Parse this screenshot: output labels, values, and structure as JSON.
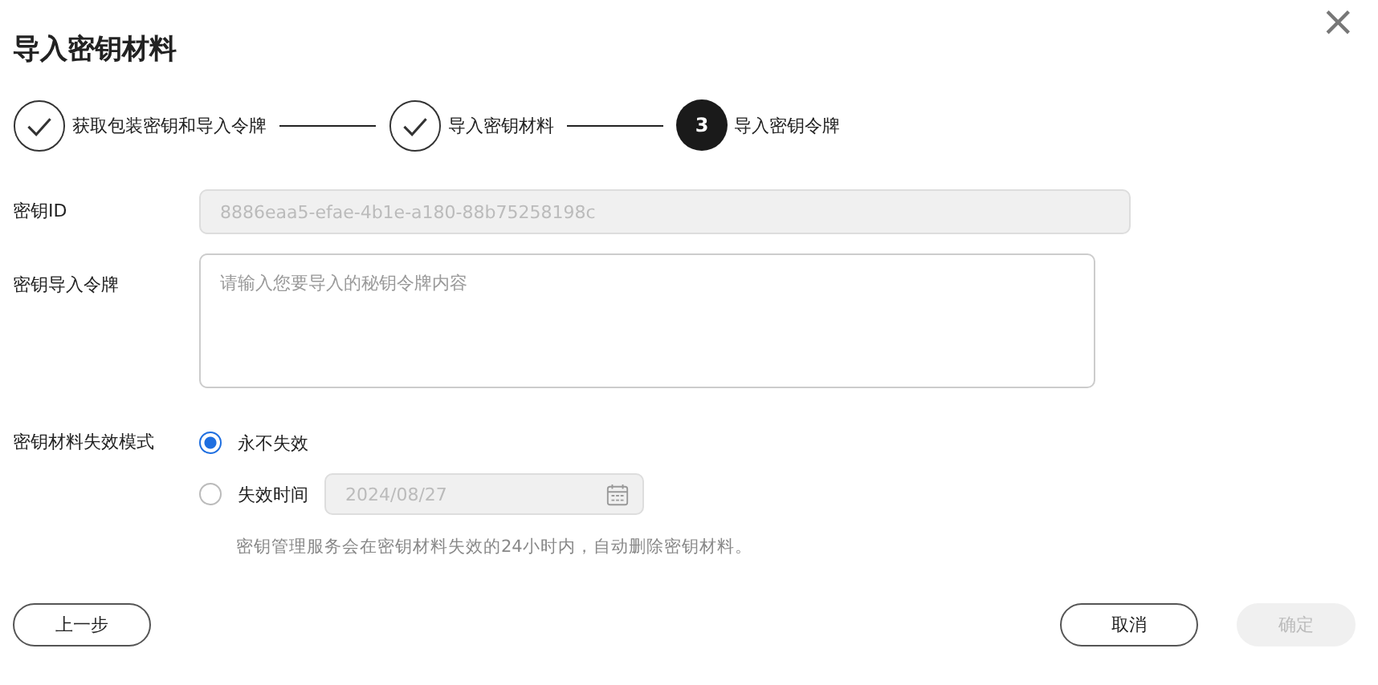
{
  "dialog": {
    "title": "导入密钥材料",
    "close": "×"
  },
  "steps": [
    {
      "label": "获取包装密钥和导入令牌",
      "done": true
    },
    {
      "label": "导入密钥材料",
      "done": true
    },
    {
      "label": "导入密钥令牌",
      "done": false,
      "number": "3"
    }
  ],
  "key_id": {
    "label": "密钥ID",
    "value": "8886eaa5-efae-4b1e-a180-88b75258198c",
    "disabled": true
  },
  "token": {
    "label": "密钥导入令牌",
    "placeholder": "请输入您要导入的秘钥令牌内容"
  },
  "expiry": {
    "label": "密钥材料失效模式",
    "options": [
      {
        "label": "永不失效",
        "selected": true
      },
      {
        "label": "失效时间",
        "selected": false
      }
    ],
    "date": {
      "value": "2024/08/27",
      "disabled": true
    },
    "hint": "密钥管理服务会在密钥材料失效的24小时内，自动删除密钥材料。"
  },
  "buttons": {
    "back": {
      "label": "上一步",
      "disabled": false
    },
    "cancel": {
      "label": "取消",
      "disabled": false
    },
    "confirm": {
      "label": "确定",
      "disabled": true
    }
  }
}
